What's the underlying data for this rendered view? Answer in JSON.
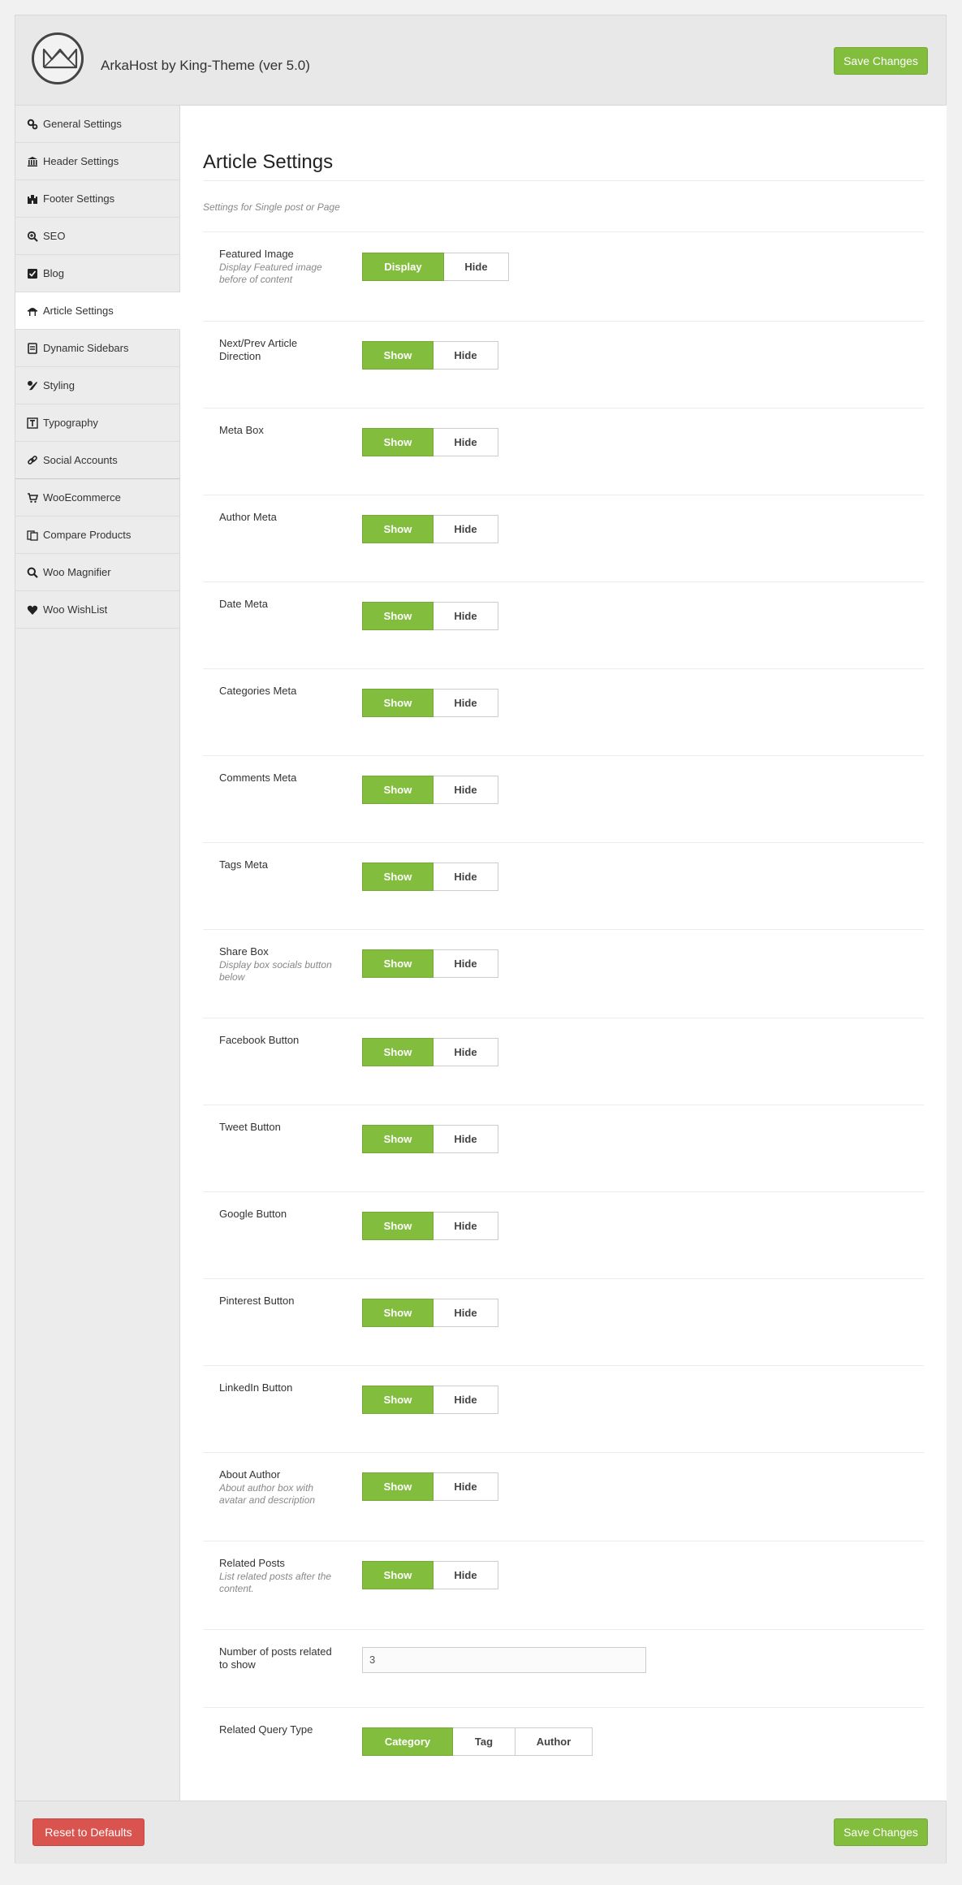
{
  "header": {
    "title": "ArkaHost by King-Theme (ver 5.0)",
    "save_label": "Save Changes"
  },
  "sidebar": {
    "items": [
      {
        "label": "General Settings",
        "icon": "gears-icon"
      },
      {
        "label": "Header Settings",
        "icon": "bank-icon"
      },
      {
        "label": "Footer Settings",
        "icon": "castle-icon"
      },
      {
        "label": "SEO",
        "icon": "search-plus-icon"
      },
      {
        "label": "Blog",
        "icon": "checkbox-icon"
      },
      {
        "label": "Article Settings",
        "icon": "desk-icon"
      },
      {
        "label": "Dynamic Sidebars",
        "icon": "stack-icon"
      },
      {
        "label": "Styling",
        "icon": "paint-icon"
      },
      {
        "label": "Typography",
        "icon": "typography-icon"
      },
      {
        "label": "Social Accounts",
        "icon": "link-icon"
      },
      {
        "label": "WooEcommerce",
        "icon": "cart-icon"
      },
      {
        "label": "Compare Products",
        "icon": "compare-icon"
      },
      {
        "label": "Woo Magnifier",
        "icon": "magnifier-icon"
      },
      {
        "label": "Woo WishList",
        "icon": "heart-icon"
      }
    ]
  },
  "main": {
    "title": "Article Settings",
    "subtitle": "Settings for Single post or Page",
    "settings": [
      {
        "label": "Featured Image",
        "desc": "Display Featured image before of content",
        "options": [
          "Display",
          "Hide"
        ],
        "selected": 0
      },
      {
        "label": "Next/Prev Article Direction",
        "desc": "",
        "options": [
          "Show",
          "Hide"
        ],
        "selected": 0
      },
      {
        "label": "Meta Box",
        "desc": "",
        "options": [
          "Show",
          "Hide"
        ],
        "selected": 0
      },
      {
        "label": "Author Meta",
        "desc": "",
        "options": [
          "Show",
          "Hide"
        ],
        "selected": 0
      },
      {
        "label": "Date Meta",
        "desc": "",
        "options": [
          "Show",
          "Hide"
        ],
        "selected": 0
      },
      {
        "label": "Categories Meta",
        "desc": "",
        "options": [
          "Show",
          "Hide"
        ],
        "selected": 0
      },
      {
        "label": "Comments Meta",
        "desc": "",
        "options": [
          "Show",
          "Hide"
        ],
        "selected": 0
      },
      {
        "label": "Tags Meta",
        "desc": "",
        "options": [
          "Show",
          "Hide"
        ],
        "selected": 0
      },
      {
        "label": "Share Box",
        "desc": "Display box socials button below",
        "options": [
          "Show",
          "Hide"
        ],
        "selected": 0
      },
      {
        "label": "Facebook Button",
        "desc": "",
        "options": [
          "Show",
          "Hide"
        ],
        "selected": 0
      },
      {
        "label": "Tweet Button",
        "desc": "",
        "options": [
          "Show",
          "Hide"
        ],
        "selected": 0
      },
      {
        "label": "Google Button",
        "desc": "",
        "options": [
          "Show",
          "Hide"
        ],
        "selected": 0
      },
      {
        "label": "Pinterest Button",
        "desc": "",
        "options": [
          "Show",
          "Hide"
        ],
        "selected": 0
      },
      {
        "label": "LinkedIn Button",
        "desc": "",
        "options": [
          "Show",
          "Hide"
        ],
        "selected": 0
      },
      {
        "label": "About Author",
        "desc": "About author box with avatar and description",
        "options": [
          "Show",
          "Hide"
        ],
        "selected": 0
      },
      {
        "label": "Related Posts",
        "desc": "List related posts after the content.",
        "options": [
          "Show",
          "Hide"
        ],
        "selected": 0
      }
    ],
    "related_count": {
      "label": "Number of posts related to show",
      "value": "3"
    },
    "query_type": {
      "label": "Related Query Type",
      "options": [
        "Category",
        "Tag",
        "Author"
      ],
      "selected": 0
    }
  },
  "footer": {
    "reset_label": "Reset to Defaults",
    "save_label": "Save Changes"
  },
  "colors": {
    "accent": "#82bd3e",
    "danger": "#d9534f"
  }
}
